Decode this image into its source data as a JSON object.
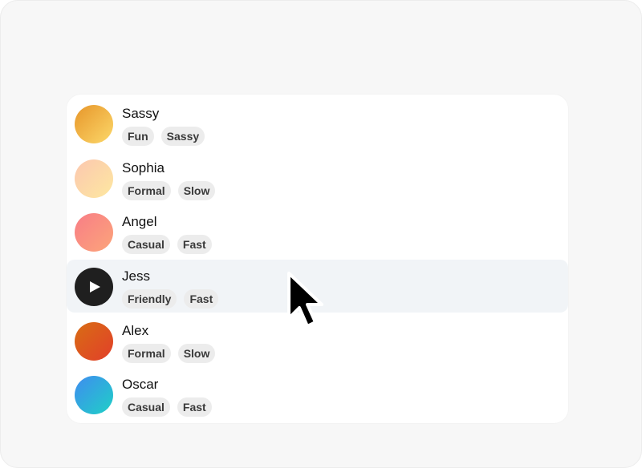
{
  "voices": [
    {
      "name": "Sassy",
      "tags": [
        "Fun",
        "Sassy"
      ],
      "gradient": [
        "#e7962a",
        "#fcd86a"
      ]
    },
    {
      "name": "Sophia",
      "tags": [
        "Formal",
        "Slow"
      ],
      "gradient": [
        "#fcc7b0",
        "#fde8a0"
      ]
    },
    {
      "name": "Angel",
      "tags": [
        "Casual",
        "Fast"
      ],
      "gradient": [
        "#f87d86",
        "#fca57a"
      ]
    },
    {
      "name": "Jess",
      "tags": [
        "Friendly",
        "Fast"
      ],
      "gradient": [
        "#1f1f1f",
        "#1f1f1f"
      ],
      "state": "playing"
    },
    {
      "name": "Alex",
      "tags": [
        "Formal",
        "Slow"
      ],
      "gradient": [
        "#d86d14",
        "#e23f2a"
      ]
    },
    {
      "name": "Oscar",
      "tags": [
        "Casual",
        "Fast"
      ],
      "gradient": [
        "#3f8cf0",
        "#1fd0c6"
      ]
    }
  ],
  "colors": {
    "background": "#f7f7f7",
    "panel": "#ffffff",
    "hover_row": "#f1f4f7",
    "tag_background": "#ececec",
    "tag_text": "#3a3a3a"
  },
  "icons": {
    "playing": "play-icon",
    "pointer": "mouse-pointer-icon"
  }
}
